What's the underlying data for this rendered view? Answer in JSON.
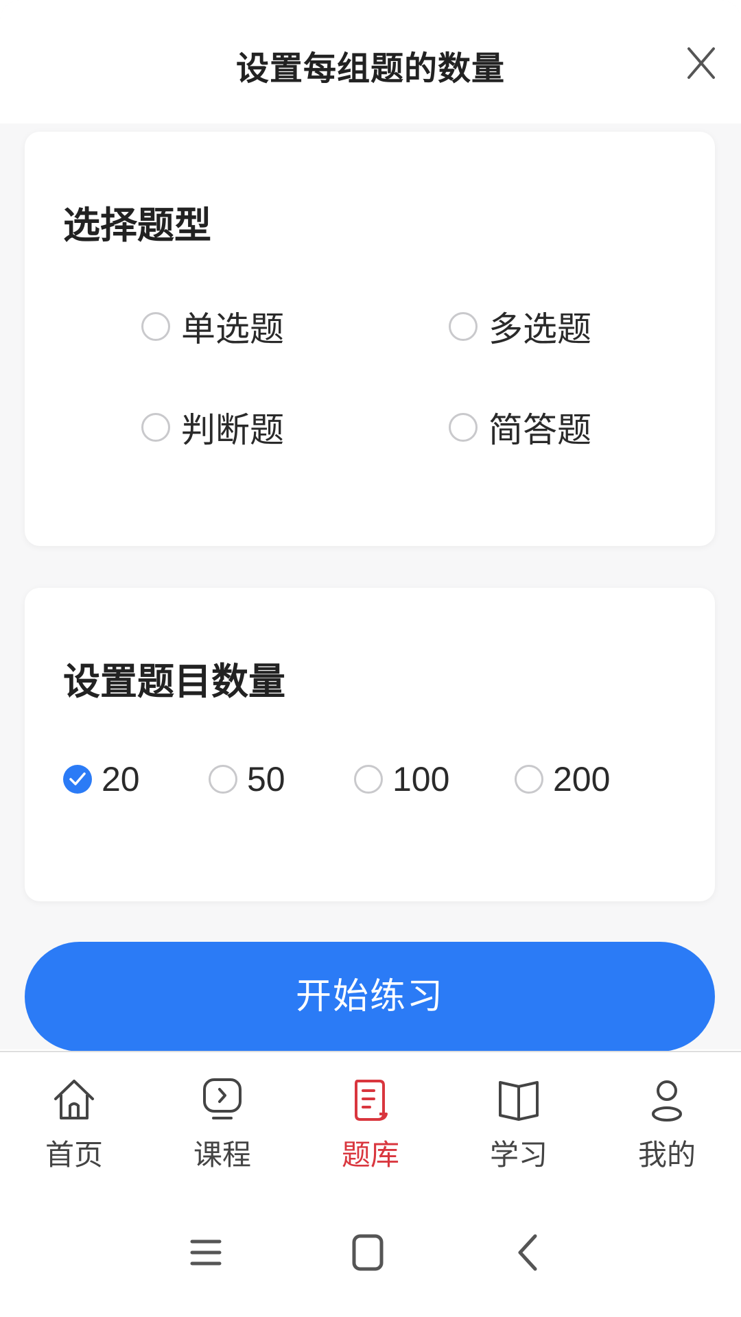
{
  "sheet": {
    "title": "设置每组题的数量",
    "close_icon": "close-icon"
  },
  "question_type": {
    "title": "选择题型",
    "options": [
      {
        "label": "单选题",
        "checked": false
      },
      {
        "label": "多选题",
        "checked": false
      },
      {
        "label": "判断题",
        "checked": false
      },
      {
        "label": "简答题",
        "checked": false
      }
    ]
  },
  "question_count": {
    "title": "设置题目数量",
    "options": [
      {
        "label": "20",
        "checked": true
      },
      {
        "label": "50",
        "checked": false
      },
      {
        "label": "100",
        "checked": false
      },
      {
        "label": "200",
        "checked": false
      }
    ]
  },
  "start_button": {
    "label": "开始练习"
  },
  "bottom_nav": {
    "items": [
      {
        "label": "首页",
        "icon": "home-icon",
        "active": false
      },
      {
        "label": "课程",
        "icon": "course-play-icon",
        "active": false
      },
      {
        "label": "题库",
        "icon": "question-bank-icon",
        "active": true
      },
      {
        "label": "学习",
        "icon": "book-icon",
        "active": false
      },
      {
        "label": "我的",
        "icon": "profile-icon",
        "active": false
      }
    ]
  },
  "colors": {
    "accent": "#2b7bf6",
    "active_nav": "#d9363e",
    "background": "#f7f7f8"
  }
}
